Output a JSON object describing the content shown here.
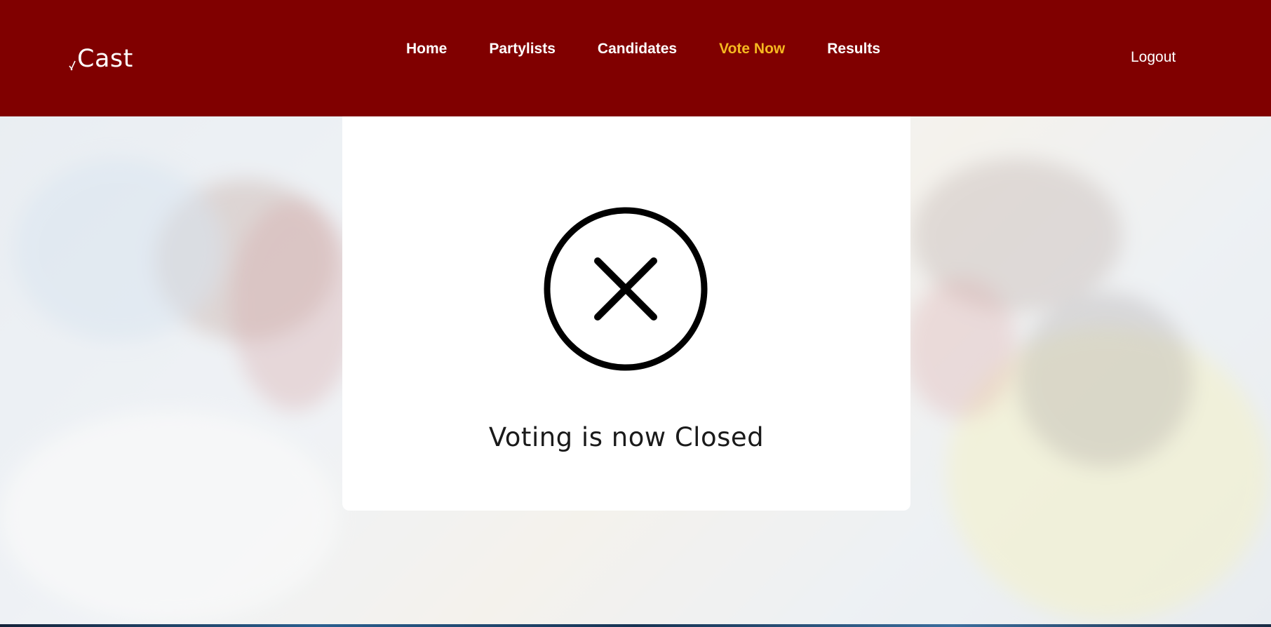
{
  "header": {
    "logo_text": "Cast",
    "nav": [
      {
        "label": "Home"
      },
      {
        "label": "Partylists"
      },
      {
        "label": "Candidates"
      },
      {
        "label": "Vote Now"
      },
      {
        "label": "Results"
      }
    ],
    "active_nav": "Vote Now",
    "logout_label": "Logout"
  },
  "main": {
    "status_icon": "close-circle-icon",
    "status_message": "Voting is now Closed"
  },
  "colors": {
    "header_bg": "#800000",
    "active_nav": "#f5b820",
    "card_bg": "#ffffff"
  }
}
